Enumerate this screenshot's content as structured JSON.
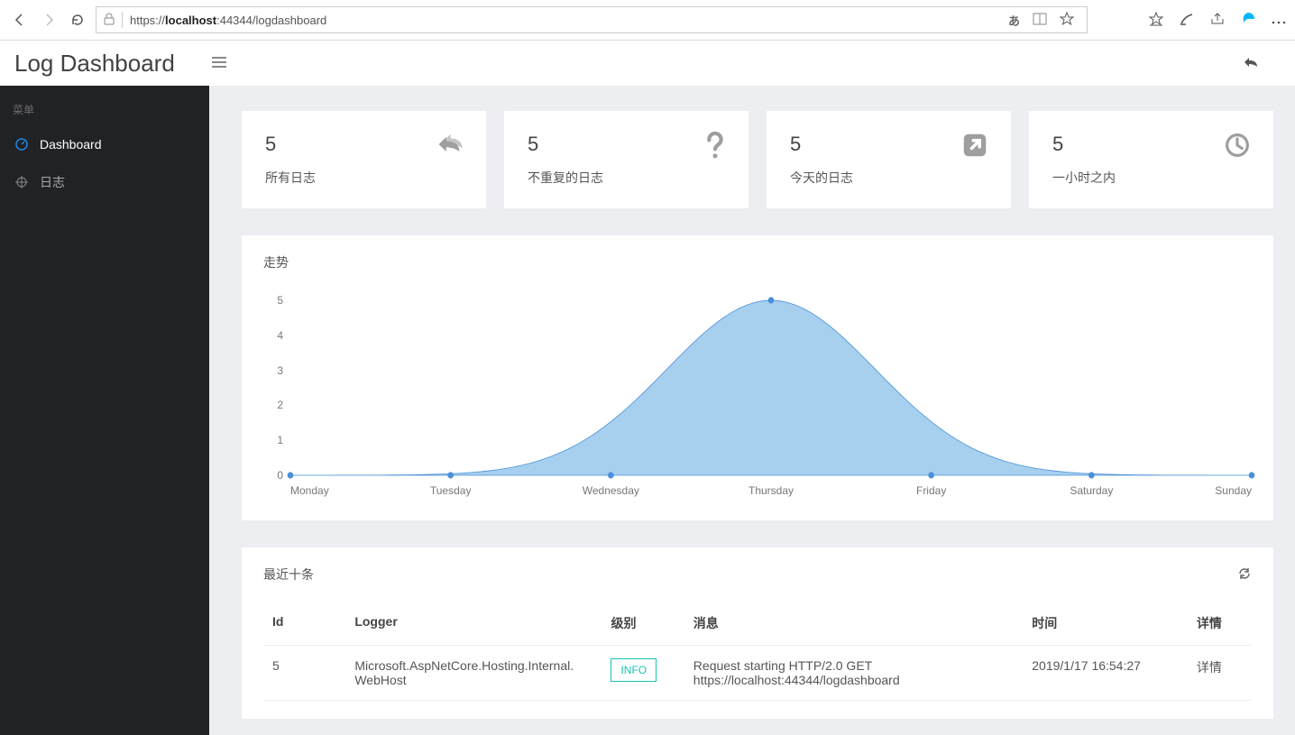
{
  "browser": {
    "url_pre": "https://",
    "url_host": "localhost",
    "url_rest": ":44344/logdashboard"
  },
  "header": {
    "title": "Log Dashboard"
  },
  "sidebar": {
    "menu_label": "菜单",
    "items": [
      {
        "label": "Dashboard",
        "active": true
      },
      {
        "label": "日志",
        "active": false
      }
    ]
  },
  "stats": [
    {
      "value": "5",
      "label": "所有日志",
      "icon": "reply-icon"
    },
    {
      "value": "5",
      "label": "不重复的日志",
      "icon": "question-icon"
    },
    {
      "value": "5",
      "label": "今天的日志",
      "icon": "external-icon"
    },
    {
      "value": "5",
      "label": "一小时之内",
      "icon": "clock-icon"
    }
  ],
  "chart_title": "走势",
  "chart_data": {
    "type": "area",
    "categories": [
      "Monday",
      "Tuesday",
      "Wednesday",
      "Thursday",
      "Friday",
      "Saturday",
      "Sunday"
    ],
    "values": [
      0,
      0,
      0,
      5,
      0,
      0,
      0
    ],
    "ylim": [
      0,
      5
    ],
    "ylabel": "",
    "xlabel": "",
    "title": "走势",
    "fill": "#a7d0ef",
    "stroke": "#4a90d9"
  },
  "recent": {
    "title": "最近十条",
    "columns": {
      "id": "Id",
      "logger": "Logger",
      "level": "级别",
      "msg": "消息",
      "time": "时间",
      "action": "详情"
    },
    "rows": [
      {
        "id": "5",
        "logger": "Microsoft.AspNetCore.Hosting.Internal.WebHost",
        "level": "INFO",
        "msg": "Request starting HTTP/2.0 GET https://localhost:44344/logdashboard",
        "time": "2019/1/17 16:54:27",
        "action": "详情"
      }
    ]
  }
}
